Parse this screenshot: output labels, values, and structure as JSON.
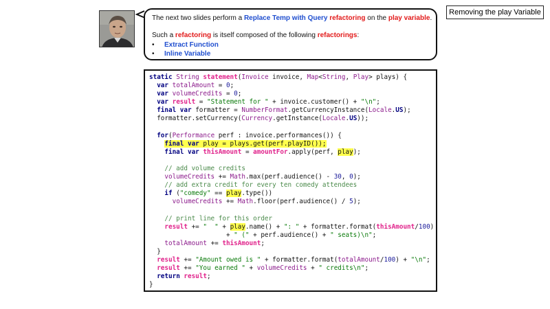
{
  "slide_title": "Removing the play Variable",
  "speech": {
    "intro": {
      "t1": "The next two slides perform a ",
      "refactoring_name": "Replace Temp with Query",
      "t2": " ",
      "refactoring_word": "refactoring",
      "t3": " on the ",
      "variable": "play variable",
      "t4": "."
    },
    "composed": {
      "t1": "Such a ",
      "refactoring_word": "refactoring",
      "t2": " is itself composed of the following ",
      "refactorings_word": "refactorings",
      "t3": ":"
    },
    "bullet_glyph": "•",
    "items": [
      "Extract Function",
      "Inline Variable"
    ]
  },
  "code_lines": [
    [
      [
        "kw",
        "static "
      ],
      [
        "ty",
        "String "
      ],
      [
        "id",
        "statement"
      ],
      [
        "p",
        "("
      ],
      [
        "ty",
        "Invoice "
      ],
      [
        "p",
        "invoice, "
      ],
      [
        "ty",
        "Map"
      ],
      [
        "p",
        "<"
      ],
      [
        "ty",
        "String"
      ],
      [
        "p",
        ", "
      ],
      [
        "ty",
        "Play"
      ],
      [
        "p",
        "> plays) {"
      ]
    ],
    [
      [
        "p",
        "  "
      ],
      [
        "kw",
        "var "
      ],
      [
        "vr",
        "totalAmount"
      ],
      [
        "p",
        " = "
      ],
      [
        "nm",
        "0"
      ],
      [
        "p",
        ";"
      ]
    ],
    [
      [
        "p",
        "  "
      ],
      [
        "kw",
        "var "
      ],
      [
        "vr",
        "volumeCredits"
      ],
      [
        "p",
        " = "
      ],
      [
        "nm",
        "0"
      ],
      [
        "p",
        ";"
      ]
    ],
    [
      [
        "p",
        "  "
      ],
      [
        "kw",
        "var "
      ],
      [
        "id",
        "result"
      ],
      [
        "p",
        " = "
      ],
      [
        "st",
        "\"Statement for \""
      ],
      [
        "p",
        " + invoice.customer() + "
      ],
      [
        "st",
        "\"\\n\""
      ],
      [
        "p",
        ";"
      ]
    ],
    [
      [
        "p",
        "  "
      ],
      [
        "kw",
        "final var "
      ],
      [
        "p",
        "formatter = "
      ],
      [
        "ty",
        "NumberFormat"
      ],
      [
        "p",
        ".getCurrencyInstance("
      ],
      [
        "ty",
        "Locale"
      ],
      [
        "p",
        "."
      ],
      [
        "kw",
        "US"
      ],
      [
        "p",
        ");"
      ]
    ],
    [
      [
        "p",
        "  formatter.setCurrency("
      ],
      [
        "ty",
        "Currency"
      ],
      [
        "p",
        ".getInstance("
      ],
      [
        "ty",
        "Locale"
      ],
      [
        "p",
        "."
      ],
      [
        "kw",
        "US"
      ],
      [
        "p",
        "));"
      ]
    ],
    [
      [
        "p",
        ""
      ]
    ],
    [
      [
        "p",
        "  "
      ],
      [
        "kw",
        "for"
      ],
      [
        "p",
        "("
      ],
      [
        "ty",
        "Performance "
      ],
      [
        "p",
        "perf : invoice.performances()) {"
      ]
    ],
    [
      [
        "p",
        "    "
      ],
      [
        "hl_kw",
        "final var "
      ],
      [
        "hl",
        "play = plays.get(perf.playID());"
      ]
    ],
    [
      [
        "p",
        "    "
      ],
      [
        "kw",
        "final var "
      ],
      [
        "id",
        "thisAmount"
      ],
      [
        "p",
        " = "
      ],
      [
        "id",
        "amountFor"
      ],
      [
        "p",
        ".apply(perf, "
      ],
      [
        "hl",
        "play"
      ],
      [
        "p",
        ");"
      ]
    ],
    [
      [
        "p",
        ""
      ]
    ],
    [
      [
        "p",
        "    "
      ],
      [
        "cm",
        "// add volume credits"
      ]
    ],
    [
      [
        "p",
        "    "
      ],
      [
        "vr",
        "volumeCredits"
      ],
      [
        "p",
        " += "
      ],
      [
        "ty",
        "Math"
      ],
      [
        "p",
        ".max(perf.audience() - "
      ],
      [
        "nm",
        "30"
      ],
      [
        "p",
        ", "
      ],
      [
        "nm",
        "0"
      ],
      [
        "p",
        ");"
      ]
    ],
    [
      [
        "p",
        "    "
      ],
      [
        "cm",
        "// add extra credit for every ten comedy attendees"
      ]
    ],
    [
      [
        "p",
        "    "
      ],
      [
        "kw",
        "if "
      ],
      [
        "p",
        "("
      ],
      [
        "st",
        "\"comedy\""
      ],
      [
        "p",
        " == "
      ],
      [
        "hl",
        "play"
      ],
      [
        "p",
        ".type())"
      ]
    ],
    [
      [
        "p",
        "      "
      ],
      [
        "vr",
        "volumeCredits"
      ],
      [
        "p",
        " += "
      ],
      [
        "ty",
        "Math"
      ],
      [
        "p",
        ".floor(perf.audience() / "
      ],
      [
        "nm",
        "5"
      ],
      [
        "p",
        ");"
      ]
    ],
    [
      [
        "p",
        ""
      ]
    ],
    [
      [
        "p",
        "    "
      ],
      [
        "cm",
        "// print line for this order"
      ]
    ],
    [
      [
        "p",
        "    "
      ],
      [
        "id",
        "result"
      ],
      [
        "p",
        " += "
      ],
      [
        "st",
        "\"  \""
      ],
      [
        "p",
        " + "
      ],
      [
        "hl",
        "play"
      ],
      [
        "p",
        ".name() + "
      ],
      [
        "st",
        "\": \""
      ],
      [
        "p",
        " + formatter.format("
      ],
      [
        "id",
        "thisAmount"
      ],
      [
        "p",
        "/"
      ],
      [
        "nm",
        "100"
      ],
      [
        "p",
        ")"
      ]
    ],
    [
      [
        "p",
        "                    + "
      ],
      [
        "st",
        "\" (\""
      ],
      [
        "p",
        " + perf.audience() + "
      ],
      [
        "st",
        "\" seats)\\n\""
      ],
      [
        "p",
        ";"
      ]
    ],
    [
      [
        "p",
        "    "
      ],
      [
        "vr",
        "totalAmount"
      ],
      [
        "p",
        " += "
      ],
      [
        "id",
        "thisAmount"
      ],
      [
        "p",
        ";"
      ]
    ],
    [
      [
        "p",
        "  }"
      ]
    ],
    [
      [
        "p",
        "  "
      ],
      [
        "id",
        "result"
      ],
      [
        "p",
        " += "
      ],
      [
        "st",
        "\"Amount owed is \""
      ],
      [
        "p",
        " + formatter.format("
      ],
      [
        "vr",
        "totalAmount"
      ],
      [
        "p",
        "/"
      ],
      [
        "nm",
        "100"
      ],
      [
        "p",
        ") + "
      ],
      [
        "st",
        "\"\\n\""
      ],
      [
        "p",
        ";"
      ]
    ],
    [
      [
        "p",
        "  "
      ],
      [
        "id",
        "result"
      ],
      [
        "p",
        " += "
      ],
      [
        "st",
        "\"You earned \""
      ],
      [
        "p",
        " + "
      ],
      [
        "vr",
        "volumeCredits"
      ],
      [
        "p",
        " + "
      ],
      [
        "st",
        "\" credits\\n\""
      ],
      [
        "p",
        ";"
      ]
    ],
    [
      [
        "p",
        "  "
      ],
      [
        "kw",
        "return "
      ],
      [
        "id",
        "result"
      ],
      [
        "p",
        ";"
      ]
    ],
    [
      [
        "p",
        "}"
      ]
    ]
  ]
}
